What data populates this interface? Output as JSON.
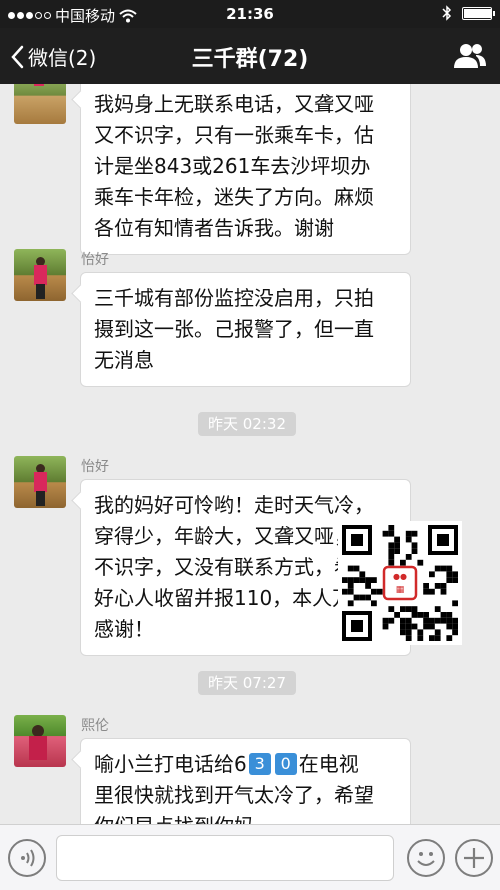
{
  "status_bar": {
    "carrier": "中国移动",
    "time": "21:36",
    "battery_level": 0.95
  },
  "nav": {
    "back_label": "微信(2)",
    "title": "三千群(72)"
  },
  "messages": [
    {
      "lines": [
        "我妈身上无联系电话，又聋又哑",
        "又不识字，只有一张乘车卡，估",
        "计是坐843或261车去沙坪坝办",
        "乘车卡年检，迷失了方向。麻烦",
        "各位有知情者告诉我。谢谢"
      ]
    },
    {
      "sender": "怡好",
      "lines": [
        "三千城有部份监控没启用，只拍",
        "摄到这一张。己报警了，但一直",
        "无消息"
      ]
    },
    {
      "sender": "怡好",
      "lines": [
        "我的妈好可怜哟！走时天气冷，",
        "穿得少，年龄大，又聋又哑，又",
        "不识字，又没有联系方式，希望",
        "好心人收留并报110，本人万分",
        "感谢！"
      ]
    },
    {
      "sender": "熙伦",
      "line1_prefix": "喻小兰打电话给6",
      "digit_boxes": [
        "3",
        "0"
      ],
      "line1_suffix": "在电视",
      "lines": [
        "里很快就找到开气太冷了，希望",
        "你们早点找到你妈。"
      ]
    }
  ],
  "timestamps": {
    "t1": "昨天 02:32",
    "t2": "昨天 07:27"
  },
  "qr_watermark": {
    "stamp_text": "微博"
  },
  "icons": {
    "wifi": "wifi-icon",
    "bluetooth": "bluetooth-icon",
    "back": "chevron-left-icon",
    "people": "group-members-icon",
    "voice": "voice-icon",
    "emoji": "emoji-icon",
    "plus": "plus-icon"
  },
  "colors": {
    "nav_bg": "#1f1f1f",
    "chat_bg": "#ebebeb",
    "keycap_blue": "#3a8fd8"
  }
}
